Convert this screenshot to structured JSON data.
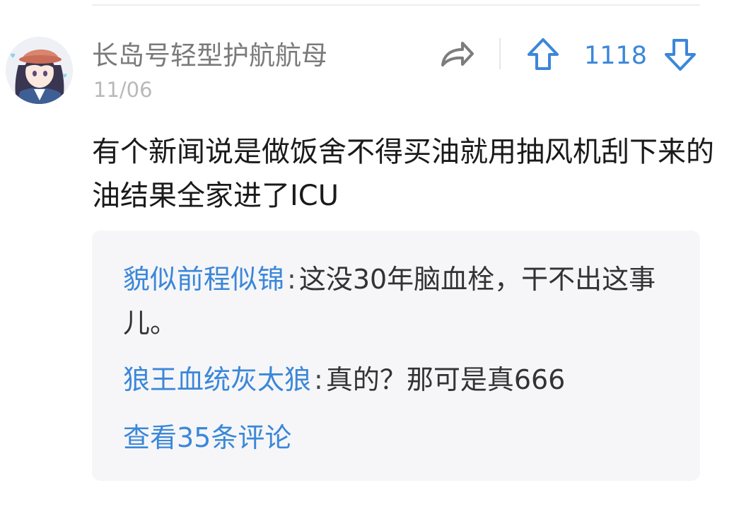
{
  "post": {
    "author": "长岛号轻型护航航母",
    "date": "11/06",
    "body": "有个新闻说是做饭舍不得买油就用抽风机刮下来的油结果全家进了ICU",
    "vote_count": "1118"
  },
  "icons": {
    "share": "share-arrow-icon",
    "upvote": "arrow-up-icon",
    "downvote": "arrow-down-icon",
    "avatar": "anime-girl-avatar"
  },
  "replies": [
    {
      "author": "貌似前程似锦",
      "separator": ":",
      "text": "这没30年脑血栓，干不出这事儿。"
    },
    {
      "author": "狼王血统灰太狼",
      "separator": ":",
      "text": "真的？那可是真666"
    }
  ],
  "view_all_label": "查看35条评论",
  "colors": {
    "accent": "#3b87d9",
    "text": "#1a1a1a",
    "muted": "#7a7a7a",
    "date": "#b9b9b9",
    "reply_bg": "#f6f6f8"
  }
}
